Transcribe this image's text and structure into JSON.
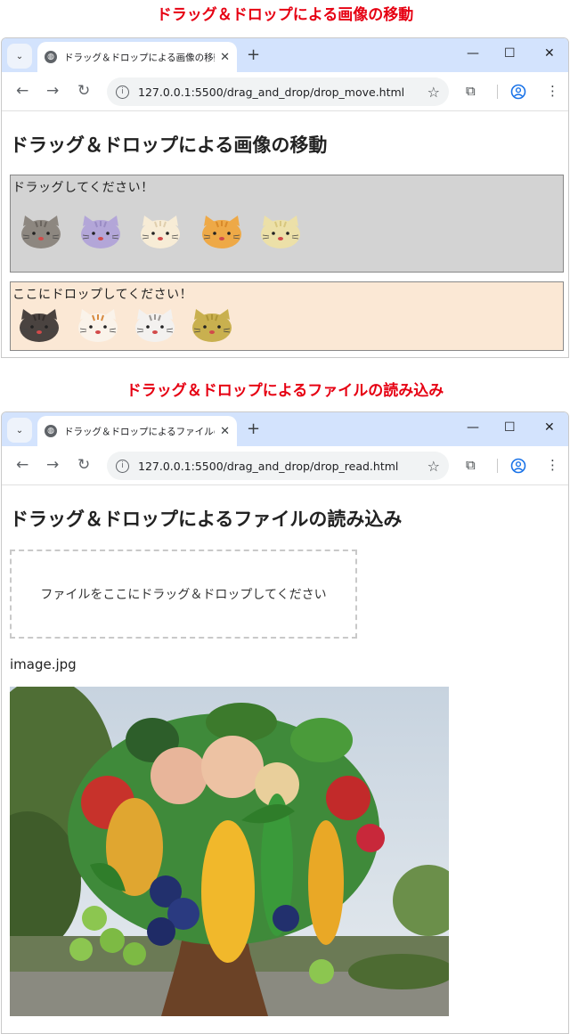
{
  "captions": {
    "top": "ドラッグ＆ドロップによる画像の移動",
    "middle": "ドラッグ＆ドロップによるファイルの読み込み"
  },
  "windows": [
    {
      "tab_title": "ドラッグ＆ドロップによる画像の移動",
      "url": "127.0.0.1:5500/drag_and_drop/drop_move.html",
      "page_title": "ドラッグ＆ドロップによる画像の移動"
    },
    {
      "tab_title": "ドラッグ＆ドロップによるファイルの読み込み",
      "url": "127.0.0.1:5500/drag_and_drop/drop_read.html",
      "page_title": "ドラッグ＆ドロップによるファイルの読み込み"
    }
  ],
  "browser": {
    "new_tab": "+",
    "close_tab": "✕",
    "minimize": "—",
    "maximize": "☐",
    "close": "✕",
    "back": "←",
    "forward": "→",
    "reload": "↻",
    "star": "☆",
    "menu": "⋮",
    "extensions": "⧉",
    "tab_menu": "⌄",
    "icons": [
      "tab-search-icon",
      "globe-icon",
      "close-icon",
      "plus-icon",
      "minimize-icon",
      "maximize-icon",
      "back-icon",
      "forward-icon",
      "reload-icon",
      "info-icon",
      "star-icon",
      "puzzle-icon",
      "profile-icon",
      "kebab-menu-icon"
    ]
  },
  "move_page": {
    "drag_label": "ドラッグしてください！",
    "drop_label": "ここにドロップしてください！",
    "drag_cats": [
      {
        "name": "gray-tabby",
        "color": "#8d8780",
        "stripe": "#6a645e"
      },
      {
        "name": "lavender",
        "color": "#b3a6d8",
        "stripe": "#9a8cc4"
      },
      {
        "name": "cream",
        "color": "#f7ecd6",
        "stripe": "#e0cfae"
      },
      {
        "name": "orange-tabby",
        "color": "#eea947",
        "stripe": "#d98a2a"
      },
      {
        "name": "pale-yellow",
        "color": "#ece0a8",
        "stripe": "#d8c77f"
      }
    ],
    "drop_cats": [
      {
        "name": "dark",
        "color": "#4a4340",
        "stripe": "#352f2d"
      },
      {
        "name": "calico",
        "color": "#faf3ea",
        "stripe": "#d88a3f"
      },
      {
        "name": "white-gray",
        "color": "#f3f1ef",
        "stripe": "#9c9894"
      },
      {
        "name": "olive",
        "color": "#c9b04f",
        "stripe": "#ad9537"
      }
    ]
  },
  "read_page": {
    "drop_text": "ファイルをここにドラッグ＆ドロップしてください",
    "file_name": "image.jpg"
  }
}
